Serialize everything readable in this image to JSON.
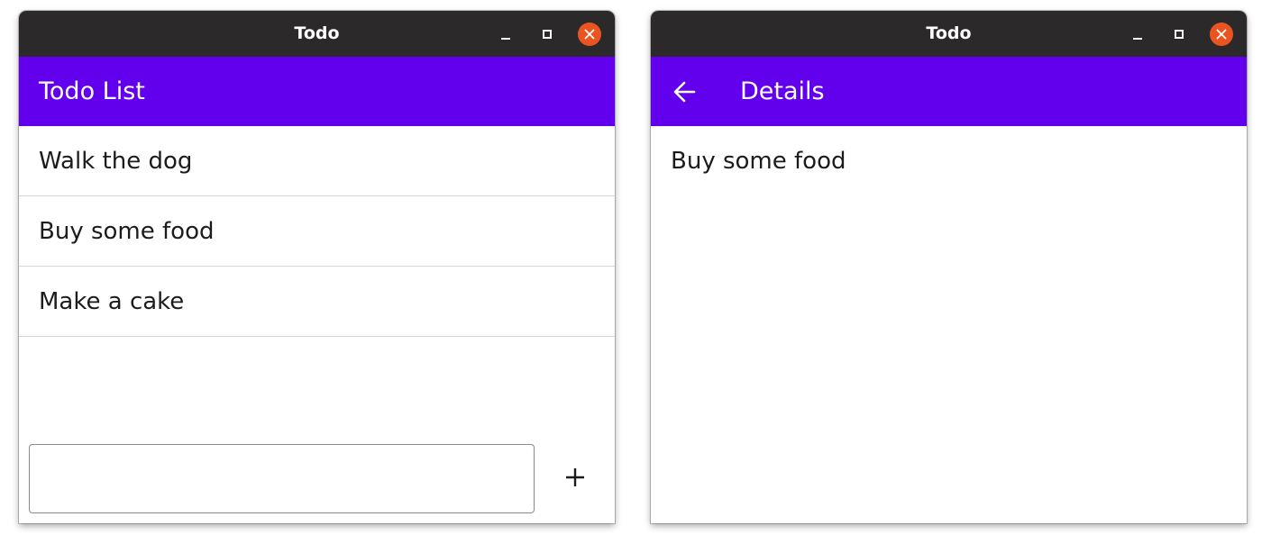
{
  "windows": [
    {
      "title": "Todo",
      "appbar": {
        "title": "Todo List"
      },
      "todos": [
        {
          "label": "Walk the dog"
        },
        {
          "label": "Buy some food"
        },
        {
          "label": "Make a cake"
        }
      ],
      "new_todo": {
        "value": "",
        "placeholder": ""
      },
      "add_button": {
        "icon": "plus-icon"
      }
    },
    {
      "title": "Todo",
      "appbar": {
        "title": "Details",
        "back_icon": "arrow-left-icon"
      },
      "detail": {
        "text": "Buy some food"
      }
    }
  ],
  "window_controls": {
    "icons": [
      "minimize-icon",
      "maximize-icon",
      "close-icon"
    ],
    "close_color": "#e95420"
  },
  "colors": {
    "titlebar": "#2b2929",
    "appbar": "#6200ee",
    "divider": "#d6d6d6",
    "text": "#1c1c1c"
  }
}
